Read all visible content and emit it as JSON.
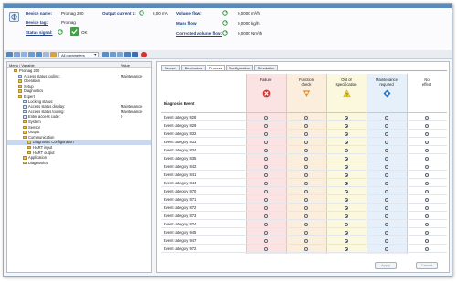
{
  "header": {
    "device_name_label": "Device name:",
    "device_name_value": "Promag 200",
    "device_tag_label": "Device tag:",
    "device_tag_value": "Promag",
    "status_signal_label": "Status signal:",
    "status_signal_value": "OK",
    "output_current_label": "Output current 1:",
    "output_current_value": "6,00 mA",
    "volume_flow_label": "Volume flow:",
    "volume_flow_value": "0,0000 m³/h",
    "mass_flow_label": "Mass flow:",
    "mass_flow_value": "0,0000 kg/h",
    "corrected_volume_flow_label": "Corrected volume flow:",
    "corrected_volume_flow_value": "0,0000 Nm³/h"
  },
  "toolbar": {
    "parameter_filter": "All parameters"
  },
  "tree": {
    "col_menu": "Menu / Variable",
    "col_value": "Value",
    "items": [
      {
        "label": "Promag 200",
        "value": "",
        "indent": 1,
        "icon": "folder",
        "selected": false
      },
      {
        "label": "Access status tooling:",
        "value": "Maintenance",
        "indent": 2,
        "icon": "leaf",
        "selected": false
      },
      {
        "label": "Operation",
        "value": "",
        "indent": 2,
        "icon": "folder",
        "selected": false
      },
      {
        "label": "Setup",
        "value": "",
        "indent": 2,
        "icon": "folder",
        "selected": false
      },
      {
        "label": "Diagnostics",
        "value": "",
        "indent": 2,
        "icon": "folder",
        "selected": false
      },
      {
        "label": "Expert",
        "value": "",
        "indent": 2,
        "icon": "folder",
        "selected": false
      },
      {
        "label": "Locking status:",
        "value": "",
        "indent": 3,
        "icon": "leaf",
        "selected": false
      },
      {
        "label": "Access status display:",
        "value": "Maintenance",
        "indent": 3,
        "icon": "leaf",
        "selected": false
      },
      {
        "label": "Access status tooling:",
        "value": "Maintenance",
        "indent": 3,
        "icon": "leaf",
        "selected": false
      },
      {
        "label": "Enter access code:",
        "value": "0",
        "indent": 3,
        "icon": "leaf",
        "selected": false
      },
      {
        "label": "System",
        "value": "",
        "indent": 3,
        "icon": "folder",
        "selected": false
      },
      {
        "label": "Sensor",
        "value": "",
        "indent": 3,
        "icon": "folder",
        "selected": false
      },
      {
        "label": "Output",
        "value": "",
        "indent": 3,
        "icon": "folder",
        "selected": false
      },
      {
        "label": "Communication",
        "value": "",
        "indent": 3,
        "icon": "folder",
        "selected": false
      },
      {
        "label": "Diagnostic Configuration",
        "value": "",
        "indent": 4,
        "icon": "folder",
        "selected": true
      },
      {
        "label": "HART input",
        "value": "",
        "indent": 4,
        "icon": "folder",
        "selected": false
      },
      {
        "label": "HART output",
        "value": "",
        "indent": 4,
        "icon": "folder",
        "selected": false
      },
      {
        "label": "Application",
        "value": "",
        "indent": 3,
        "icon": "folder",
        "selected": false
      },
      {
        "label": "Diagnostics",
        "value": "",
        "indent": 3,
        "icon": "folder",
        "selected": false
      }
    ]
  },
  "tabs": [
    "Sensor",
    "Electronics",
    "Process",
    "Configuration",
    "Simulation"
  ],
  "active_tab": 2,
  "grid": {
    "diagnosis_label": "Diagnosis Event",
    "columns": [
      {
        "label_1": "Failure",
        "label_2": "",
        "bg": "#fbe3e3",
        "icon": "failure-icon",
        "icon_color": "#d8322e"
      },
      {
        "label_1": "Function",
        "label_2": "check",
        "bg": "#fbeedd",
        "icon": "function-check-icon",
        "icon_color": "#e48a1f"
      },
      {
        "label_1": "Out of",
        "label_2": "specification",
        "bg": "#fbf8de",
        "icon": "out-of-spec-icon",
        "icon_color": "#efd12a"
      },
      {
        "label_1": "Maintenance",
        "label_2": "required",
        "bg": "#e5f0fb",
        "icon": "maintenance-icon",
        "icon_color": "#2c7ac4"
      },
      {
        "label_1": "No",
        "label_2": "effect",
        "bg": "#ffffff",
        "icon": "",
        "icon_color": ""
      }
    ],
    "rows": [
      {
        "label": "Event category 828",
        "selected": 2
      },
      {
        "label": "Event category 829",
        "selected": 2
      },
      {
        "label": "Event category 832",
        "selected": 2
      },
      {
        "label": "Event category 833",
        "selected": 2
      },
      {
        "label": "Event category 834",
        "selected": 2
      },
      {
        "label": "Event category 835",
        "selected": 2
      },
      {
        "label": "Event category 842",
        "selected": 2
      },
      {
        "label": "Event category 841",
        "selected": 2
      },
      {
        "label": "Event category 844",
        "selected": 2
      },
      {
        "label": "Event category 870",
        "selected": 2
      },
      {
        "label": "Event category 871",
        "selected": 2
      },
      {
        "label": "Event category 872",
        "selected": 2
      },
      {
        "label": "Event category 873",
        "selected": 2
      },
      {
        "label": "Event category 874",
        "selected": 2
      },
      {
        "label": "Event category 945",
        "selected": 2
      },
      {
        "label": "Event category 947",
        "selected": 2
      },
      {
        "label": "Event category 972",
        "selected": 2
      }
    ]
  },
  "buttons": {
    "apply": "Apply",
    "cancel": "Cancel"
  }
}
